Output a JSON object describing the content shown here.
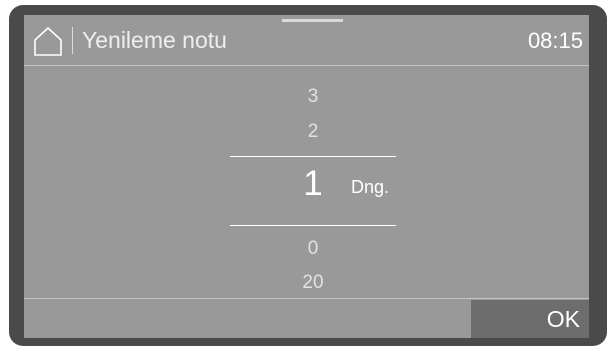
{
  "header": {
    "title": "Yenileme notu",
    "time": "08:15",
    "home_icon": "home-icon"
  },
  "picker": {
    "values_above": [
      "3",
      "2"
    ],
    "selected_value": "1",
    "unit": "Dng.",
    "values_below": [
      "0",
      "20"
    ]
  },
  "footer": {
    "ok_label": "OK"
  },
  "colors": {
    "screen_background": "#999999",
    "bezel": "#4a4a4a",
    "ok_button": "#6d6d6d",
    "text": "#ffffff"
  }
}
